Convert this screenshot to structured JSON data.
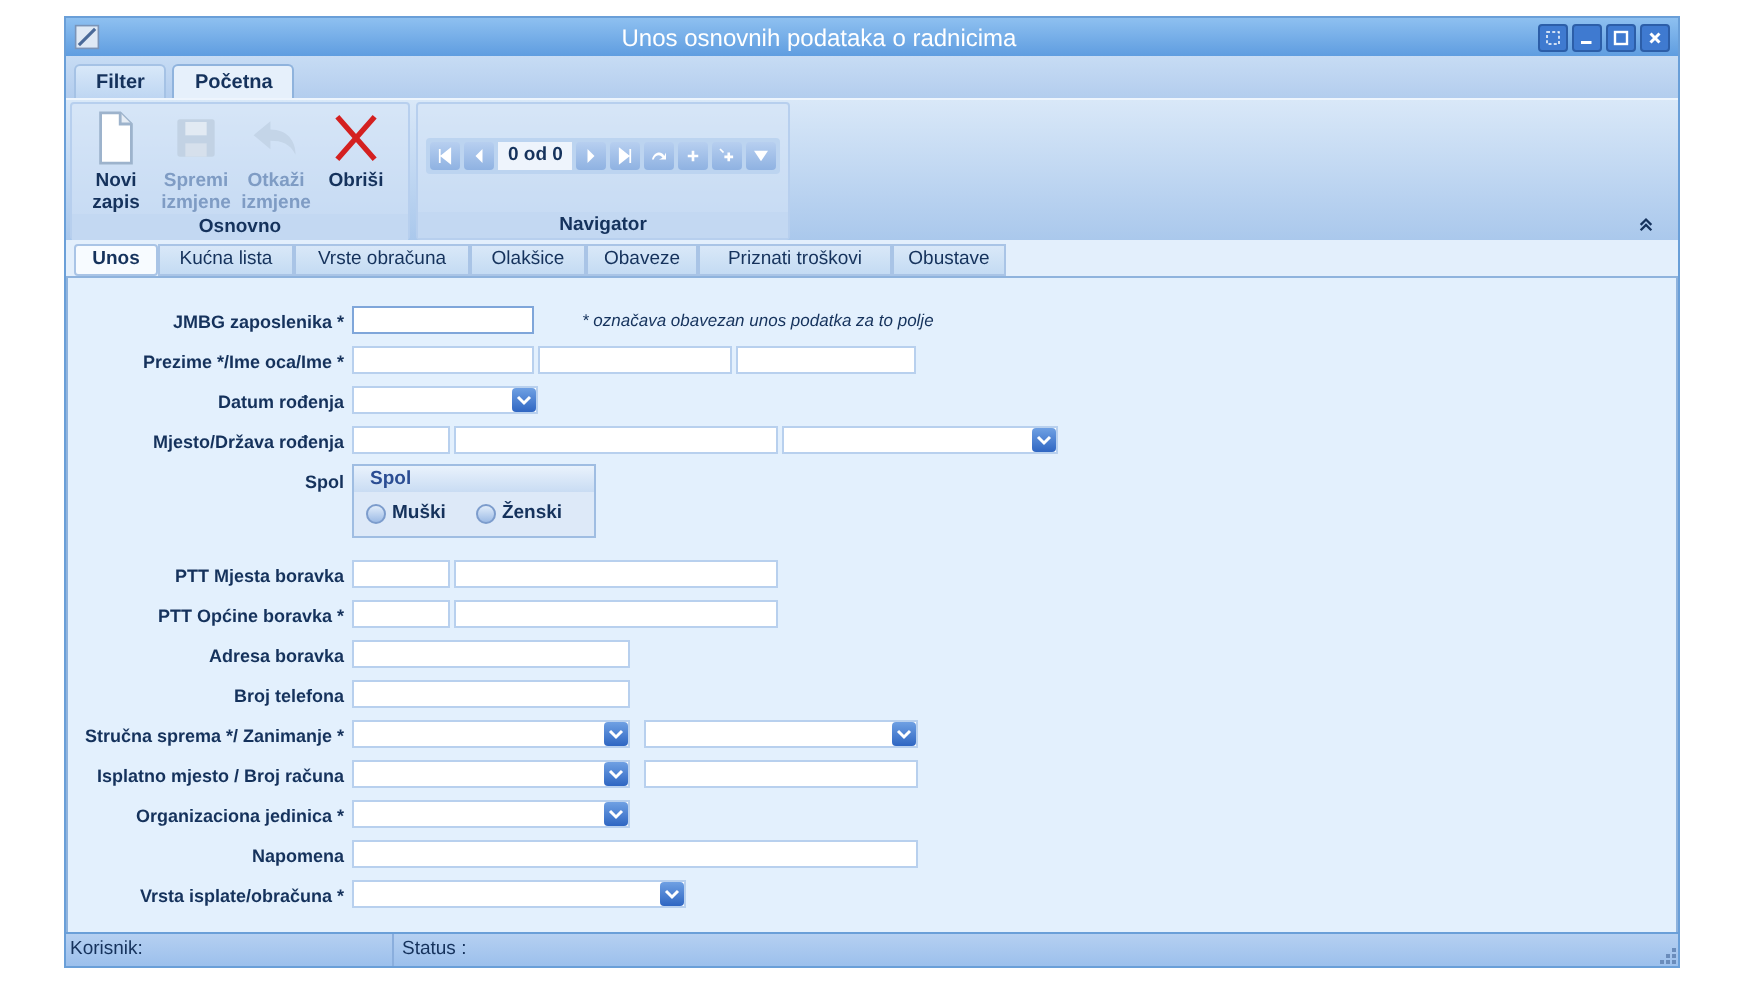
{
  "window": {
    "title": "Unos osnovnih podataka o radnicima"
  },
  "ribbon_tabs": [
    {
      "label": "Filter",
      "selected": false
    },
    {
      "label": "Početna",
      "selected": true
    }
  ],
  "ribbon_groups": [
    {
      "label": "Osnovno",
      "buttons": [
        {
          "kind": "new",
          "label": "Novi zapis",
          "disabled": false
        },
        {
          "kind": "save",
          "label": "Spremi izmjene",
          "disabled": true
        },
        {
          "kind": "undo",
          "label": "Otkaži izmjene",
          "disabled": true
        },
        {
          "kind": "delete",
          "label": "Obriši",
          "disabled": false
        }
      ]
    },
    {
      "label": "Navigator",
      "position": "0 od 0"
    }
  ],
  "form_tabs": [
    {
      "label": "Unos",
      "selected": true
    },
    {
      "label": "Kućna lista",
      "selected": false
    },
    {
      "label": "Vrste obračuna",
      "selected": false
    },
    {
      "label": "Olakšice",
      "selected": false
    },
    {
      "label": "Obaveze",
      "selected": false
    },
    {
      "label": "Priznati troškovi",
      "selected": false
    },
    {
      "label": "Obustave",
      "selected": false
    }
  ],
  "required_note": "* označava obavezan unos podatka za to polje",
  "form_rows": [
    {
      "label": "JMBG zaposlenika *",
      "fields": [
        {
          "kind": "text"
        }
      ]
    },
    {
      "label": "Prezime */Ime oca/Ime *",
      "fields": [
        {
          "kind": "text"
        },
        {
          "kind": "text"
        },
        {
          "kind": "text"
        }
      ]
    },
    {
      "label": "Datum rođenja",
      "fields": [
        {
          "kind": "combo"
        }
      ]
    },
    {
      "label": "Mjesto/Država rođenja",
      "fields": [
        {
          "kind": "text"
        },
        {
          "kind": "text"
        },
        {
          "kind": "combo"
        }
      ]
    },
    {
      "label": "Spol",
      "kind": "radio_group",
      "group_title": "Spol",
      "options": [
        {
          "label": "Muški",
          "checked": false
        },
        {
          "label": "Ženski",
          "checked": false
        }
      ]
    },
    {
      "label": "PTT Mjesta boravka",
      "fields": [
        {
          "kind": "text"
        },
        {
          "kind": "text"
        }
      ]
    },
    {
      "label": "PTT Općine boravka *",
      "fields": [
        {
          "kind": "text"
        },
        {
          "kind": "text"
        }
      ]
    },
    {
      "label": "Adresa boravka",
      "fields": [
        {
          "kind": "text"
        }
      ]
    },
    {
      "label": "Broj telefona",
      "fields": [
        {
          "kind": "text"
        }
      ]
    },
    {
      "label": "Stručna sprema */ Zanimanje *",
      "fields": [
        {
          "kind": "combo"
        },
        {
          "kind": "combo"
        }
      ]
    },
    {
      "label": "Isplatno mjesto / Broj računa",
      "fields": [
        {
          "kind": "combo"
        },
        {
          "kind": "text"
        }
      ]
    },
    {
      "label": "Organizaciona jedinica *",
      "fields": [
        {
          "kind": "combo"
        }
      ]
    },
    {
      "label": "Napomena",
      "fields": [
        {
          "kind": "text"
        }
      ]
    },
    {
      "label": "Vrsta isplate/obračuna *",
      "fields": [
        {
          "kind": "combo"
        }
      ]
    }
  ],
  "status_bar": {
    "user_label": "Korisnik:",
    "status_label": "Status :"
  }
}
